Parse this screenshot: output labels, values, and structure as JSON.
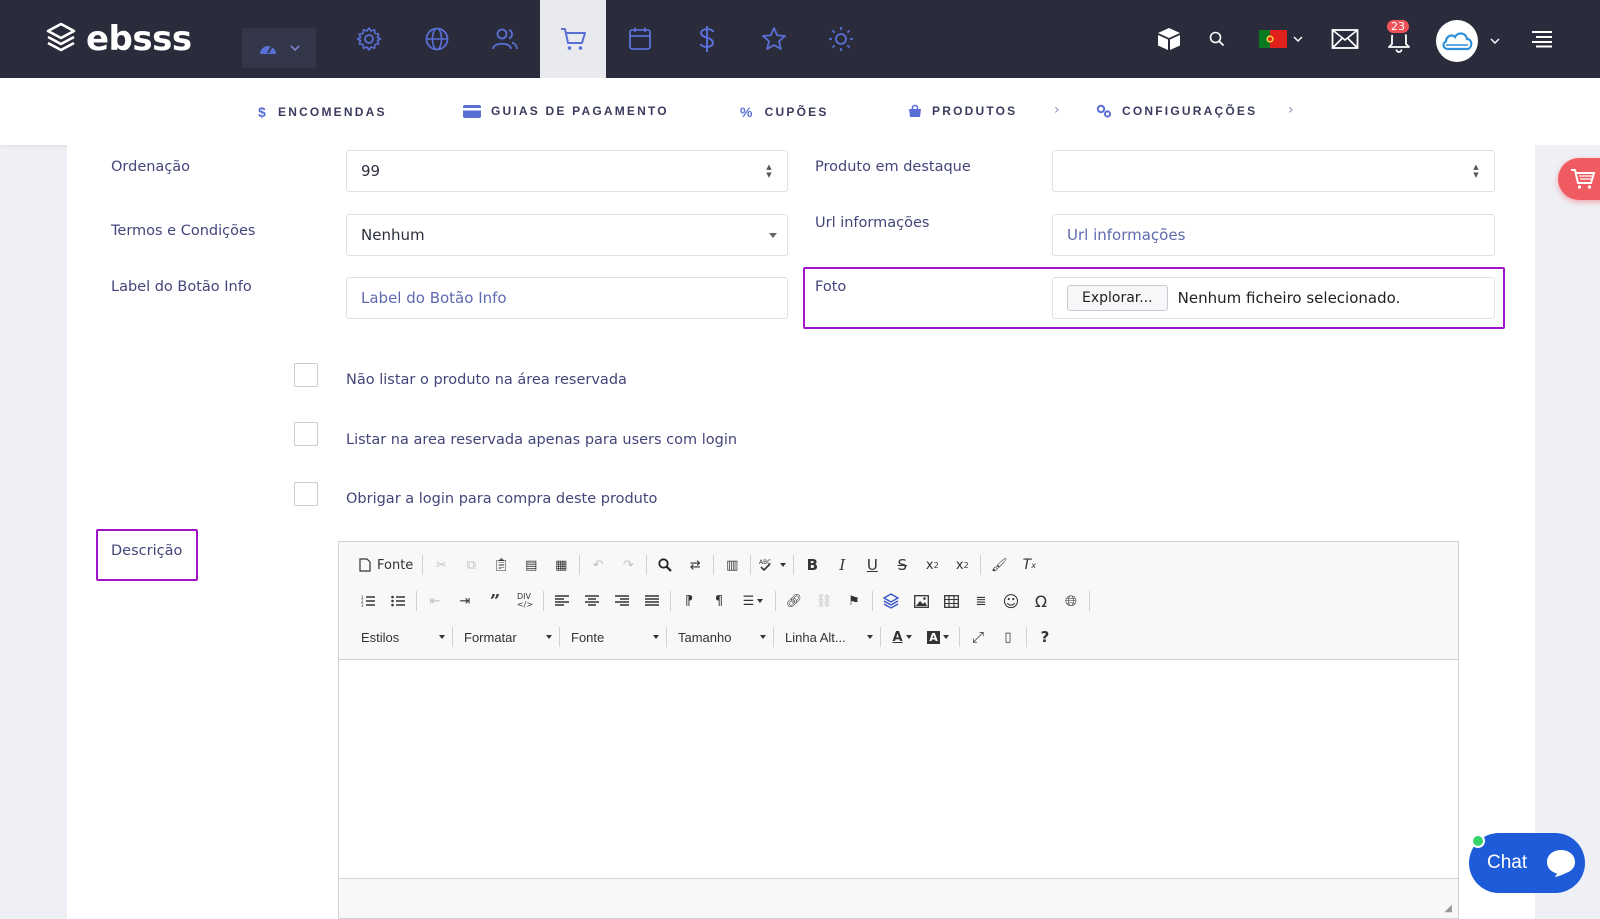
{
  "brand": {
    "name": "ebsss"
  },
  "topbar": {
    "badge_count": "23",
    "active_nav": "cart"
  },
  "subnav": {
    "items": [
      {
        "label": "ENCOMENDAS",
        "icon": "$"
      },
      {
        "label": "GUIAS DE PAGAMENTO",
        "icon": "card"
      },
      {
        "label": "CUPÕES",
        "icon": "%"
      },
      {
        "label": "PRODUTOS",
        "icon": "bag"
      },
      {
        "label": "CONFIGURAÇÕES",
        "icon": "gears"
      }
    ]
  },
  "form": {
    "ordenacao": {
      "label": "Ordenação",
      "value": "99"
    },
    "produto_destaque": {
      "label": "Produto em destaque",
      "value": ""
    },
    "termos": {
      "label": "Termos e Condições",
      "value": "Nenhum"
    },
    "url_info": {
      "label": "Url informações",
      "placeholder": "Url informações"
    },
    "label_botao": {
      "label": "Label do Botão Info",
      "placeholder": "Label do Botão Info"
    },
    "foto": {
      "label": "Foto",
      "button": "Explorar...",
      "status": "Nenhum ficheiro selecionado."
    },
    "checkboxes": [
      {
        "label": "Não listar o produto na área reservada",
        "checked": false
      },
      {
        "label": "Listar na area reservada apenas para users com login",
        "checked": false
      },
      {
        "label": "Obrigar a login para compra deste produto",
        "checked": false
      }
    ],
    "descricao": {
      "label": "Descrição"
    }
  },
  "editor": {
    "source_label": "Fonte",
    "combos": [
      "Estilos",
      "Formatar",
      "Fonte",
      "Tamanho",
      "Linha Alt..."
    ],
    "help": "?"
  },
  "chat": {
    "label": "Chat"
  },
  "colors": {
    "topbar": "#2b2c3b",
    "accent": "#5a6fd6",
    "highlight": "#a013c8",
    "chat": "#1e5bd8",
    "badge": "#f0535a"
  }
}
